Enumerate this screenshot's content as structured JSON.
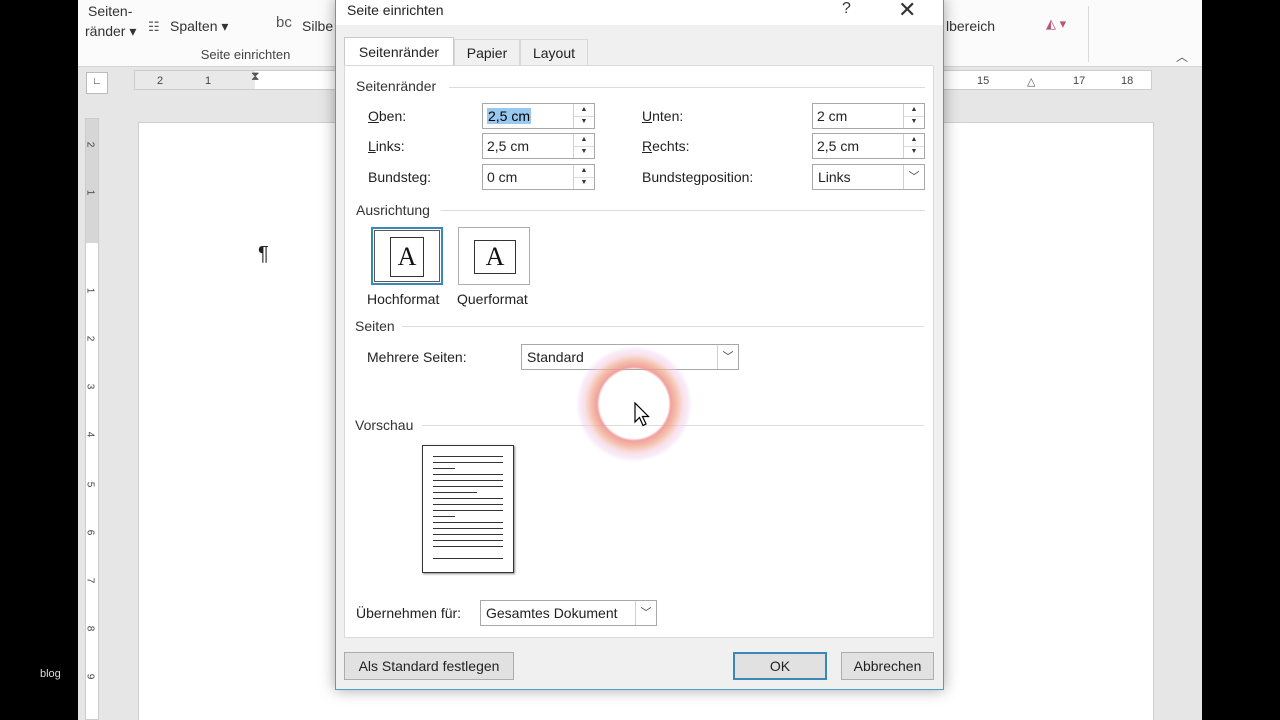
{
  "ribbon": {
    "margins_label_1": "Seiten-",
    "margins_label_2": "ränder ▾",
    "columns_label": "Spalten ▾",
    "hyphen_label": "Silbe",
    "area_label": "lbereich",
    "group_label": "Seite einrichten"
  },
  "ruler": {
    "h_ticks": [
      "2",
      "1",
      "15",
      "17",
      "18"
    ],
    "v_ticks": [
      "2",
      "1",
      "1",
      "2",
      "3",
      "4",
      "5",
      "6",
      "7",
      "8",
      "9"
    ]
  },
  "document": {
    "pilcrow": "¶"
  },
  "watermark": "blog",
  "dialog": {
    "title": "Seite einrichten",
    "help": "?",
    "close": "✕",
    "tabs": [
      "Seitenränder",
      "Papier",
      "Layout"
    ],
    "margins": {
      "section": "Seitenränder",
      "top_label": "Oben:",
      "top_value": "2,5 cm",
      "bottom_label": "Unten:",
      "bottom_value": "2 cm",
      "left_label": "Links:",
      "left_value": "2,5 cm",
      "right_label": "Rechts:",
      "right_value": "2,5 cm",
      "gutter_label": "Bundsteg:",
      "gutter_value": "0 cm",
      "gutter_pos_label": "Bundstegposition:",
      "gutter_pos_value": "Links"
    },
    "orientation": {
      "section": "Ausrichtung",
      "portrait": "Hochformat",
      "landscape": "Querformat",
      "glyph": "A"
    },
    "pages": {
      "section": "Seiten",
      "multiple_label": "Mehrere Seiten:",
      "multiple_value": "Standard"
    },
    "preview": {
      "section": "Vorschau"
    },
    "apply": {
      "label": "Übernehmen für:",
      "value": "Gesamtes Dokument"
    },
    "buttons": {
      "set_default": "Als Standard festlegen",
      "ok": "OK",
      "cancel": "Abbrechen"
    }
  },
  "colors": {
    "accent": "#3a88b8",
    "selection": "#99c9ef",
    "dialog_bg": "#f0f0f0"
  }
}
